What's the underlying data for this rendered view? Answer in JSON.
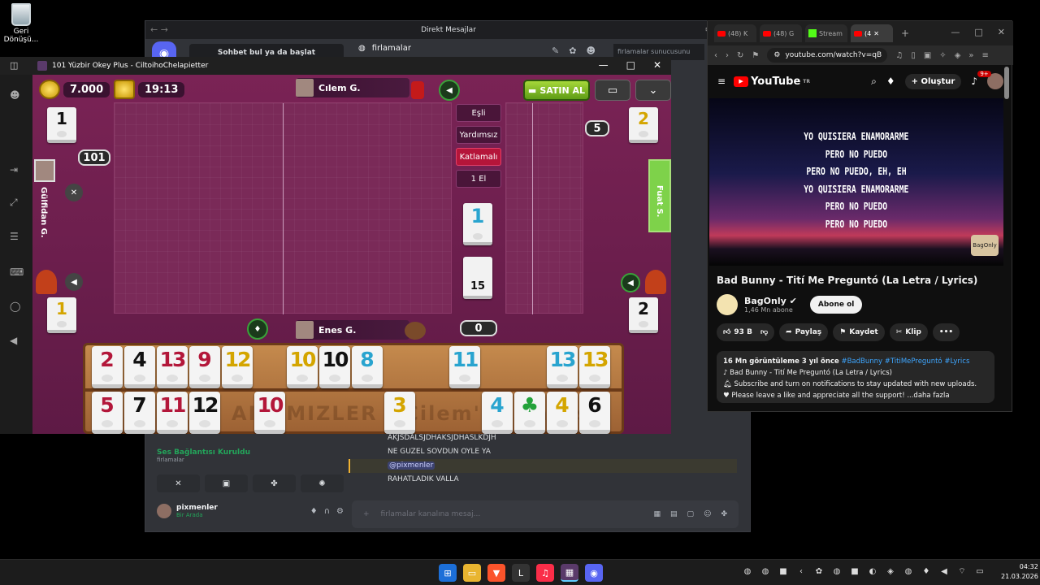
{
  "desktop": {
    "recycle_label": "Geri Dönüşü..."
  },
  "discord": {
    "title": "Direkt Mesajlar",
    "search": "Sohbet bul ya da başlat",
    "channel": "firlamalar",
    "channel_search": "firlamalar sunucusunu ara",
    "voice_status": "Ses Bağlantısı Kuruldu",
    "voice_server": "firlamalar",
    "user_name": "pixmenler",
    "user_status": "Bir Arada",
    "messages": [
      "AKJSDALSJDHAKSJDHASLKDJH",
      "NE GUZEL SOVDUN OYLE YA",
      "@pixmenler",
      "RAHATLADIK VALLA"
    ],
    "input_placeholder": "firlamalar kanalına mesaj..."
  },
  "okey": {
    "window_title": "101 Yüzbir Okey Plus - CiltoihoChelapietter",
    "gold": "7.000",
    "time": "19:13",
    "buy_label": "SATIN AL",
    "players": {
      "top": "Cılem G.",
      "bottom": "Enes G.",
      "left": "Gülfidan G.",
      "right": "Fuat S."
    },
    "tags": [
      "Eşli",
      "Yardımsız",
      "Katlamalı",
      "1 El"
    ],
    "score_101": "101",
    "right_count": "5",
    "bottom_count": "0",
    "indicator_tile": "1",
    "remaining_tiles": "15",
    "discard_tiles": {
      "top_left": "1",
      "top_right": "2",
      "bottom_left": "1",
      "bottom_right": "2"
    },
    "rack_watermark": "AILEMIZLER - Cilem'in Masası",
    "rack_top": [
      {
        "value": "2",
        "color": "red"
      },
      {
        "value": "4",
        "color": "black"
      },
      {
        "value": "13",
        "color": "red"
      },
      {
        "value": "9",
        "color": "red"
      },
      {
        "value": "12",
        "color": "yellow"
      },
      {
        "value": "10",
        "color": "yellow"
      },
      {
        "value": "10",
        "color": "black"
      },
      {
        "value": "8",
        "color": "blue"
      },
      {
        "value": "11",
        "color": "blue"
      },
      {
        "value": "13",
        "color": "blue"
      },
      {
        "value": "13",
        "color": "yellow"
      }
    ],
    "rack_bottom": [
      {
        "value": "5",
        "color": "red"
      },
      {
        "value": "7",
        "color": "black"
      },
      {
        "value": "11",
        "color": "red"
      },
      {
        "value": "12",
        "color": "black"
      },
      {
        "value": "10",
        "color": "red"
      },
      {
        "value": "3",
        "color": "yellow"
      },
      {
        "value": "4",
        "color": "blue"
      },
      {
        "value": "♣",
        "color": "green"
      },
      {
        "value": "4",
        "color": "yellow"
      },
      {
        "value": "6",
        "color": "black"
      }
    ]
  },
  "youtube": {
    "tabs": [
      "(48) K",
      "(48) G",
      "Stream",
      "(4"
    ],
    "url": "youtube.com/watch?v=qB",
    "logo": "YouTube",
    "region": "TR",
    "create": "Oluştur",
    "notif": "9+",
    "lyrics": [
      "YO QUISIERA ENAMORARME",
      "PERO NO PUEDO",
      "PERO NO PUEDO, EH, EH",
      "YO QUISIERA ENAMORARME",
      "PERO NO PUEDO",
      "PERO NO PUEDO"
    ],
    "watermark": "BagOnly",
    "video_title": "Bad Bunny - Tití Me Preguntó (La Letra / Lyrics)",
    "channel": "BagOnly",
    "subs": "1,46 Mn abone",
    "subscribe": "Abone ol",
    "likes": "93 B",
    "share": "Paylaş",
    "save": "Kaydet",
    "clip": "Klip",
    "desc_views": "16 Mn görüntüleme  3 yıl önce",
    "desc_tags": "#BadBunny #TitiMePreguntó #Lyrics",
    "desc_lines": [
      "Bad Bunny - Tití Me Preguntó (La Letra / Lyrics)",
      "Subscribe and turn on notifications to stay updated with new uploads.",
      "Please leave a like and appreciate all the support! ...daha fazla"
    ]
  },
  "taskbar": {
    "time": "04:32",
    "date": "21.03.2026"
  }
}
